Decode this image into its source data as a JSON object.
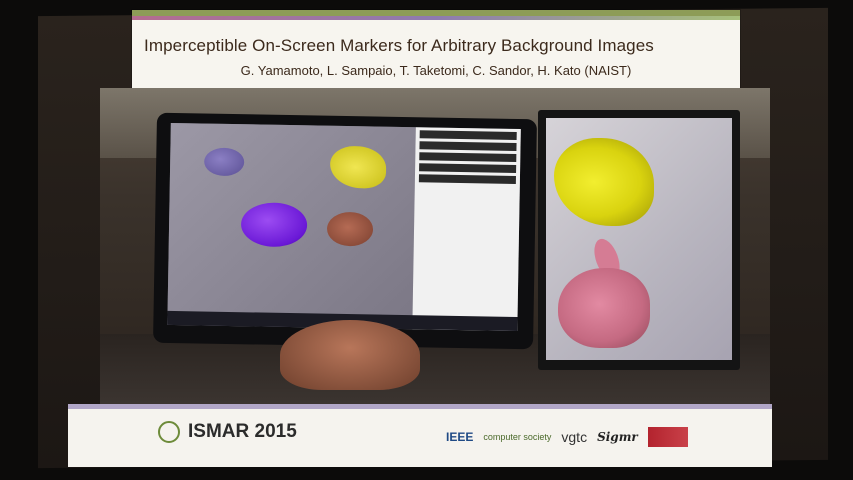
{
  "slide": {
    "title": "Imperceptible On-Screen Markers for Arbitrary Background Images",
    "authors": "G. Yamamoto, L. Sampaio, T. Taketomi, C. Sandor, H. Kato (NAIST)"
  },
  "footer": {
    "conference": "ISMAR 2015",
    "sponsors": [
      "IEEE",
      "computer society",
      "vgtc",
      "Sigmr"
    ]
  },
  "colors": {
    "slide_bg": "#f7f5ef",
    "title_text": "#3c2a1c",
    "accent_green": "#8d9c57",
    "accent_purple": "#b1a6c7"
  }
}
